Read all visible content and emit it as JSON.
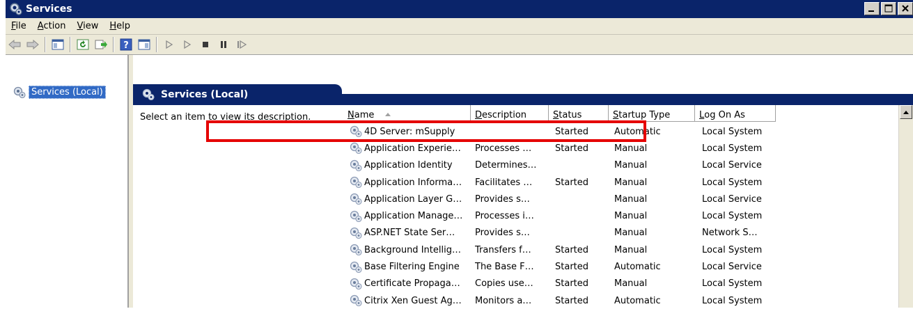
{
  "window": {
    "title": "Services"
  },
  "menu": [
    {
      "label": "File",
      "mnemonic": "F",
      "rest": "ile"
    },
    {
      "label": "Action",
      "mnemonic": "A",
      "rest": "ction"
    },
    {
      "label": "View",
      "mnemonic": "V",
      "rest": "iew"
    },
    {
      "label": "Help",
      "mnemonic": "H",
      "rest": "elp"
    }
  ],
  "toolbar": {
    "icons": [
      "back-icon",
      "forward-icon",
      "show-hide-console-tree-icon",
      "refresh-icon",
      "export-list-icon",
      "help-icon",
      "properties-icon",
      "start-service-icon",
      "start-service-alt-icon",
      "stop-service-icon",
      "pause-service-icon",
      "resume-service-icon"
    ]
  },
  "tree": {
    "selected": "Services (Local)"
  },
  "panel": {
    "title": "Services (Local)",
    "description": "Select an item to view its description."
  },
  "table": {
    "columns": {
      "name": {
        "mnemonic": "N",
        "rest": "ame"
      },
      "description": {
        "mnemonic": "D",
        "rest": "escription"
      },
      "status": {
        "mnemonic": "S",
        "rest": "tatus"
      },
      "startup_type": {
        "mnemonic": "S",
        "rest": "tartup Type"
      },
      "log_on_as": {
        "mnemonic": "L",
        "rest": "og On As"
      }
    },
    "rows": [
      {
        "name": "4D Server: mSupply",
        "description": "",
        "status": "Started",
        "startup_type": "Automatic",
        "log_on_as": "Local System"
      },
      {
        "name": "Application Experie…",
        "description": "Processes …",
        "status": "Started",
        "startup_type": "Manual",
        "log_on_as": "Local System"
      },
      {
        "name": "Application Identity",
        "description": "Determines…",
        "status": "",
        "startup_type": "Manual",
        "log_on_as": "Local Service"
      },
      {
        "name": "Application Informa…",
        "description": "Facilitates …",
        "status": "Started",
        "startup_type": "Manual",
        "log_on_as": "Local System"
      },
      {
        "name": "Application Layer G…",
        "description": "Provides s…",
        "status": "",
        "startup_type": "Manual",
        "log_on_as": "Local Service"
      },
      {
        "name": "Application Manage…",
        "description": "Processes i…",
        "status": "",
        "startup_type": "Manual",
        "log_on_as": "Local System"
      },
      {
        "name": "ASP.NET State Ser…",
        "description": "Provides s…",
        "status": "",
        "startup_type": "Manual",
        "log_on_as": "Network S…"
      },
      {
        "name": "Background Intellig…",
        "description": "Transfers f…",
        "status": "Started",
        "startup_type": "Manual",
        "log_on_as": "Local System"
      },
      {
        "name": "Base Filtering Engine",
        "description": "The Base F…",
        "status": "Started",
        "startup_type": "Automatic",
        "log_on_as": "Local Service"
      },
      {
        "name": "Certificate Propaga…",
        "description": "Copies use…",
        "status": "Started",
        "startup_type": "Manual",
        "log_on_as": "Local System"
      },
      {
        "name": "Citrix Xen Guest Ag…",
        "description": "Monitors a…",
        "status": "Started",
        "startup_type": "Automatic",
        "log_on_as": "Local System"
      }
    ]
  },
  "colors": {
    "titlebar": "#0a246a",
    "selection": "#316ac5",
    "highlight_border": "#e50000"
  }
}
